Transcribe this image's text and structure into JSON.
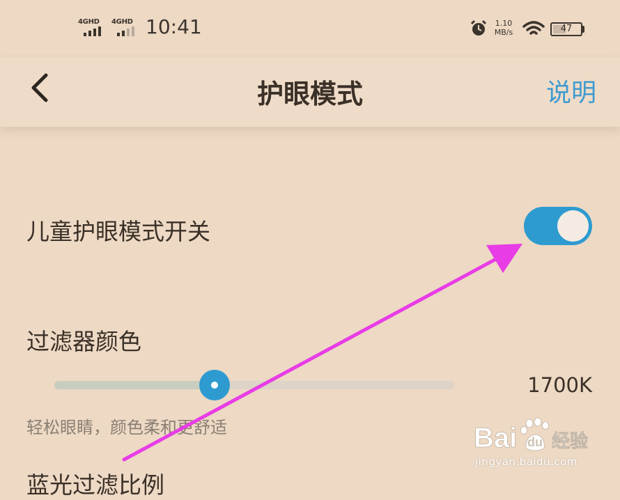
{
  "status_bar": {
    "sim1_label": "4GHD",
    "sim2_label": "4GHD",
    "time": "10:41",
    "net_speed_value": "1.10",
    "net_speed_unit": "MB/s",
    "battery_level": "47",
    "battery_fraction": 0.47
  },
  "header": {
    "title": "护眼模式",
    "help_label": "说明",
    "back_icon": "chevron-left-icon"
  },
  "settings": {
    "kids_mode_label": "儿童护眼模式开关",
    "kids_mode_on": true,
    "filter_color_label": "过滤器颜色",
    "filter_value_text": "1700K",
    "filter_slider_fraction": 0.4,
    "filter_hint": "轻松眼睛，颜色柔和更舒适",
    "blue_filter_label": "蓝光过滤比例"
  },
  "watermark": {
    "logo_text": "Bai 经验",
    "url": "jingyan.baidu.com"
  },
  "colors": {
    "background": "#edd9c4",
    "accent": "#2e9bd0",
    "annotation_arrow": "#e83ce6"
  }
}
